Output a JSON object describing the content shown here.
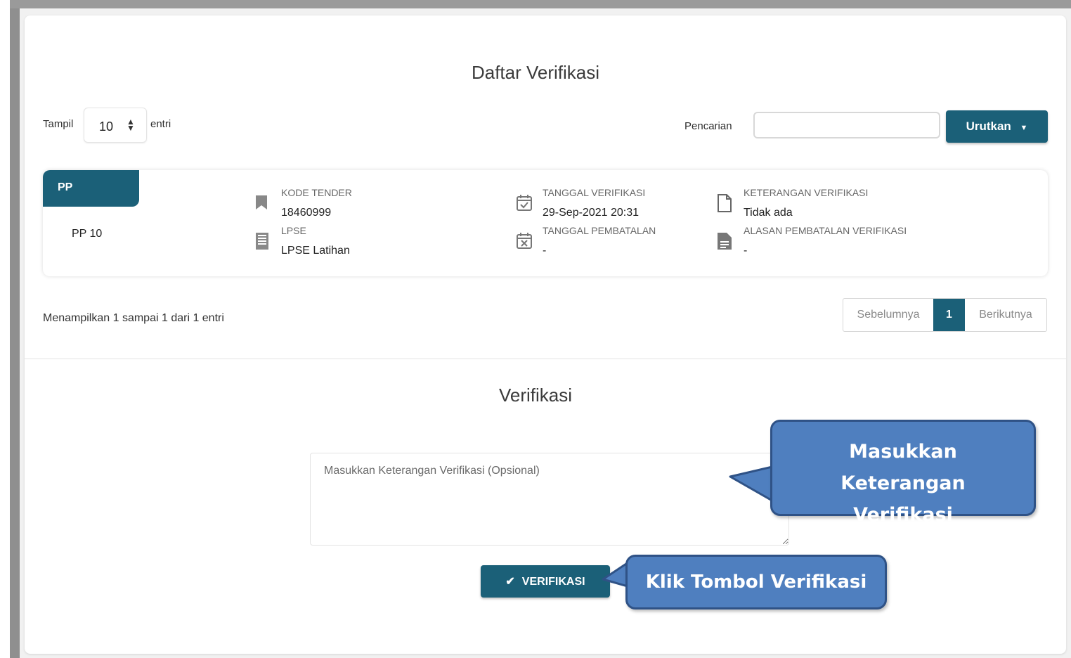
{
  "page": {
    "list_title": "Daftar Verifikasi",
    "verify_title": "Verifikasi"
  },
  "controls": {
    "show_label": "Tampil",
    "show_value": "10",
    "entries_label": "entri",
    "search_label": "Pencarian",
    "search_value": "",
    "sort_button": "Urutkan"
  },
  "record": {
    "tag": "PP",
    "name": "PP 10",
    "kode_tender_label": "KODE TENDER",
    "kode_tender": "18460999",
    "lpse_label": "LPSE",
    "lpse": "LPSE Latihan",
    "tanggal_verifikasi_label": "TANGGAL VERIFIKASI",
    "tanggal_verifikasi": "29-Sep-2021 20:31",
    "tanggal_pembatalan_label": "TANGGAL PEMBATALAN",
    "tanggal_pembatalan": "-",
    "keterangan_label": "KETERANGAN VERIFIKASI",
    "keterangan": "Tidak ada",
    "alasan_label": "ALASAN PEMBATALAN VERIFIKASI",
    "alasan": "-",
    "icons": [
      "bookmark-icon",
      "building-icon",
      "calendar-check-icon",
      "calendar-x-icon",
      "file-outline-icon",
      "file-text-icon"
    ]
  },
  "pagination": {
    "info": "Menampilkan 1 sampai 1 dari 1 entri",
    "prev": "Sebelumnya",
    "current": "1",
    "next": "Berikutnya"
  },
  "verify": {
    "placeholder": "Masukkan Keterangan Verifikasi (Opsional)",
    "button": "VERIFIKASI"
  },
  "callouts": {
    "textarea_hint": "Masukkan Keterangan Verifikasi",
    "button_hint": "Klik Tombol Verifikasi"
  },
  "colors": {
    "primary": "#1b6078",
    "callout_fill": "#4f7fbf",
    "callout_border": "#2f5286"
  }
}
